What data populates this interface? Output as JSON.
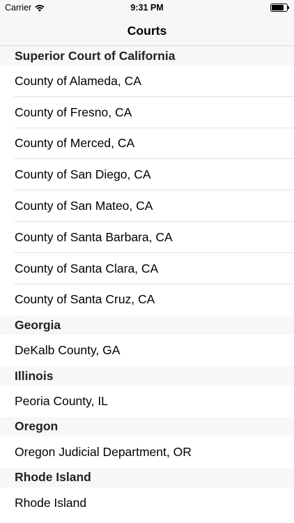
{
  "status_bar": {
    "carrier": "Carrier",
    "time": "9:31 PM",
    "battery_level": 0.8
  },
  "nav": {
    "title": "Courts"
  },
  "sections": [
    {
      "title": "Superior Court of California",
      "items": [
        "County of Alameda, CA",
        "County of Fresno, CA",
        "County of Merced, CA",
        "County of San Diego, CA",
        "County of San Mateo, CA",
        "County of Santa Barbara, CA",
        "County of Santa Clara, CA",
        "County of Santa Cruz, CA"
      ]
    },
    {
      "title": "Georgia",
      "items": [
        "DeKalb County, GA"
      ]
    },
    {
      "title": "Illinois",
      "items": [
        "Peoria County, IL"
      ]
    },
    {
      "title": "Oregon",
      "items": [
        "Oregon Judicial Department, OR"
      ]
    },
    {
      "title": "Rhode Island",
      "items": [
        "Rhode Island"
      ]
    }
  ],
  "colors": {
    "bar_background": "#f7f7f7",
    "separator": "#e2e2e4"
  }
}
